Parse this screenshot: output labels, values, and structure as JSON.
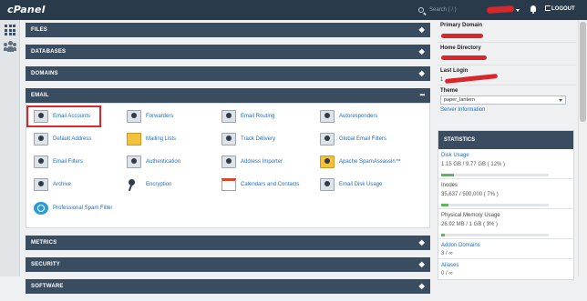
{
  "topbar": {
    "logo": "cPanel",
    "search_placeholder": "Search ( / )",
    "logout_label": "LOGOUT"
  },
  "sections": {
    "files": "FILES",
    "databases": "DATABASES",
    "domains": "DOMAINS",
    "email": "EMAIL",
    "metrics": "METRICS",
    "security": "SECURITY",
    "software": "SOFTWARE"
  },
  "email_apps": {
    "email_accounts": "Email Accounts",
    "forwarders": "Forwarders",
    "email_routing": "Email Routing",
    "autoresponders": "Autoresponders",
    "default_address": "Default Address",
    "mailing_lists": "Mailing Lists",
    "track_delivery": "Track Delivery",
    "global_email_filters": "Global Email Filters",
    "email_filters": "Email Filters",
    "authentication": "Authentication",
    "address_importer": "Address Importer",
    "apache_spamassassin": "Apache SpamAssassin™",
    "archive": "Archive",
    "encryption": "Encryption",
    "calendars_and_contacts": "Calendars and Contacts",
    "email_disk_usage": "Email Disk Usage",
    "professional_spam_filter": "Professional Spam Filter"
  },
  "sidebar": {
    "primary_domain_label": "Primary Domain",
    "home_directory_label": "Home Directory",
    "last_login_label": "Last Login",
    "last_login_prefix": "1",
    "theme_label": "Theme",
    "theme_value": "paper_lantern",
    "server_information": "Server Information",
    "statistics_title": "STATISTICS",
    "stats": {
      "disk_usage_label": "Disk Usage",
      "disk_usage_value": "1.15 GB / 9.77 GB ( 12% )",
      "disk_usage_fraction": 0.12,
      "inodes_label": "Inodes",
      "inodes_value": "35,637 / 500,000 ( 7% )",
      "inodes_fraction": 0.07,
      "memory_label": "Physical Memory Usage",
      "memory_value": "26.92 MB / 1 GB ( 3% )",
      "memory_fraction": 0.03,
      "addon_domains_label": "Addon Domains",
      "addon_domains_value": "3 / ∞",
      "aliases_label": "Aliases",
      "aliases_value": "0 / ∞"
    }
  },
  "colors": {
    "topbar": "#293a4a",
    "section_bar": "#3a4d60",
    "link": "#1f6fbf",
    "highlight": "#e0262a",
    "progress": "#5cb85c"
  }
}
